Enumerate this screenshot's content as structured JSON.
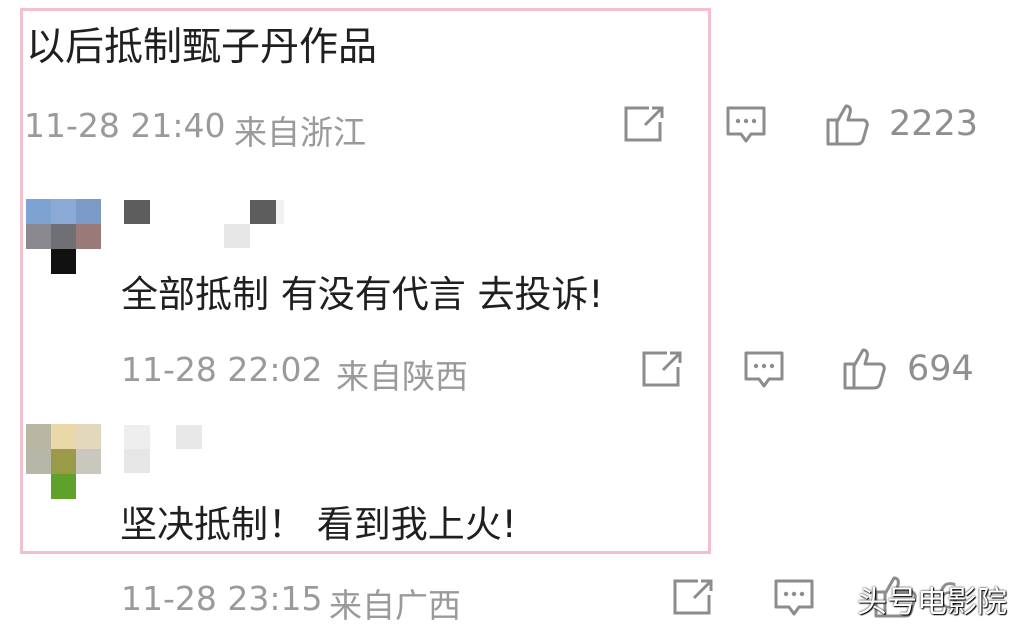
{
  "post": {
    "text": "以后抵制甄子丹作品",
    "time": "11-28 21:40",
    "location": "来自浙江",
    "likes": "2223"
  },
  "replies": [
    {
      "text": "全部抵制 有没有代言 去投诉!",
      "time": "11-28 22:02",
      "location": "来自陕西",
      "likes": "694"
    },
    {
      "text": "坚决抵制！ 看到我上火!",
      "time": "11-28 23:15",
      "location": "来自广西",
      "likes": "6"
    }
  ],
  "icons": {
    "share": "share-icon",
    "comment": "comment-icon",
    "like": "thumbs-up-icon"
  },
  "colors": {
    "highlight_border": "#f3bfcb",
    "meta_text": "#9a9a9a",
    "icon_stroke": "#8c8c8c"
  },
  "watermark": "头号电影院"
}
